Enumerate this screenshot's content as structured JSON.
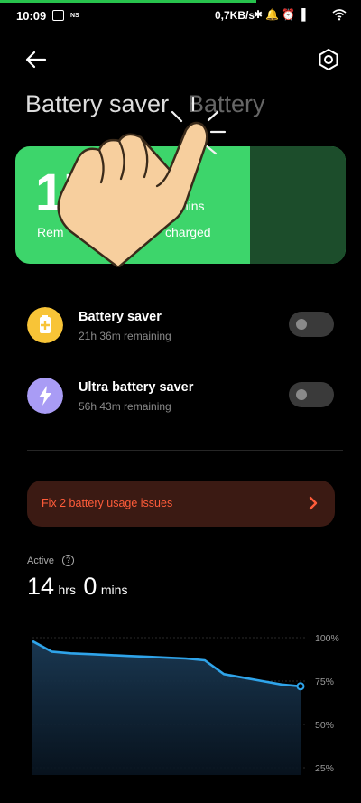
{
  "status_bar": {
    "time": "10:09",
    "badge": "NS",
    "net_speed": "0,7KB/s",
    "icons": [
      "bluetooth-icon",
      "mute-icon",
      "alarm-icon",
      "volte-icon",
      "signal-icon",
      "wifi-icon"
    ]
  },
  "header": {
    "tab_active": "Battery saver",
    "tab_inactive": "Battery"
  },
  "battery_card": {
    "value_visible": "17",
    "unit_visible": "mins",
    "label_left": "Rem",
    "label_right": "charged",
    "color": "#3dd56b"
  },
  "modes": [
    {
      "title": "Battery saver",
      "subtitle": "21h 36m remaining",
      "icon": "battery-plus-icon",
      "icon_color": "#f8c437",
      "enabled": false
    },
    {
      "title": "Ultra battery saver",
      "subtitle": "56h 43m remaining",
      "icon": "lightning-icon",
      "icon_color": "#a99cf5",
      "enabled": false
    }
  ],
  "issues_banner": {
    "text": "Fix 2 battery usage issues",
    "color": "#ff5c3a"
  },
  "active": {
    "label": "Active",
    "hours": "14",
    "hours_unit": "hrs",
    "minutes": "0",
    "minutes_unit": "mins"
  },
  "chart_data": {
    "type": "area",
    "y_ticks": [
      "100%",
      "75%",
      "50%",
      "25%"
    ],
    "ylim": [
      25,
      100
    ],
    "x": [
      0,
      1,
      2,
      3,
      4,
      5,
      6,
      7,
      8,
      9,
      10,
      11,
      12,
      13,
      14
    ],
    "values": [
      98,
      92,
      91,
      90.5,
      90,
      89.5,
      89,
      88.5,
      88,
      87,
      79,
      77,
      75,
      73,
      72
    ],
    "color": "#2fa4ea"
  }
}
